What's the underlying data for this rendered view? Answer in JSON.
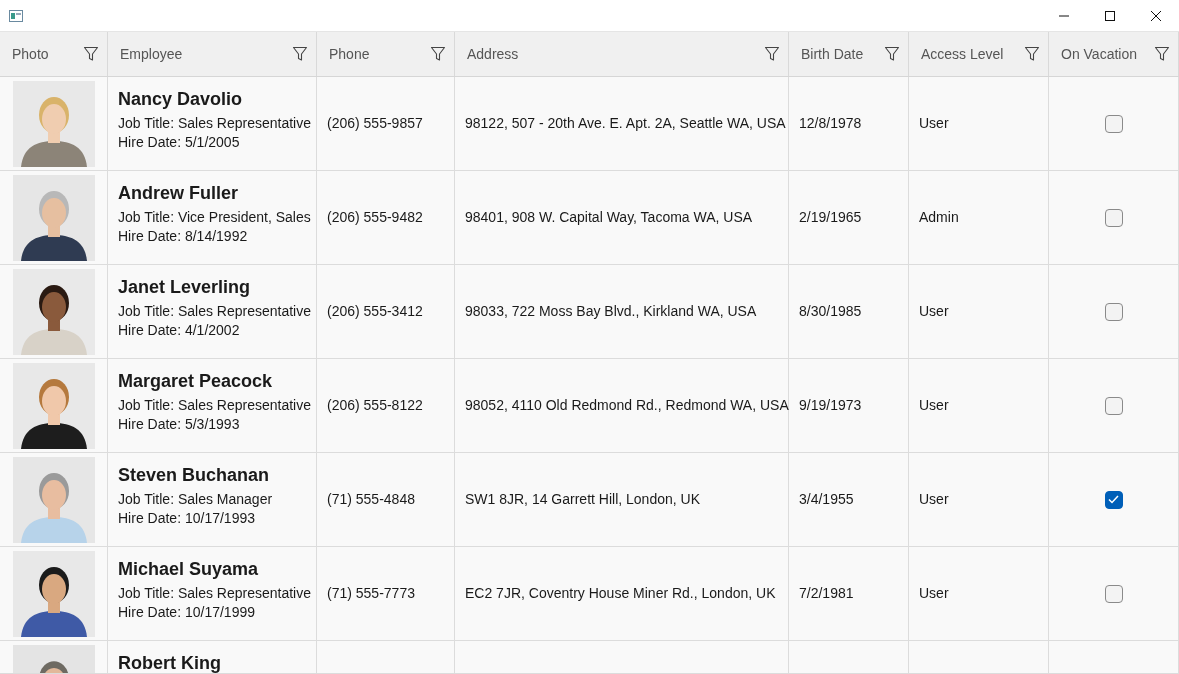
{
  "columns": [
    {
      "label": "Photo"
    },
    {
      "label": "Employee"
    },
    {
      "label": "Phone"
    },
    {
      "label": "Address"
    },
    {
      "label": "Birth Date"
    },
    {
      "label": "Access Level"
    },
    {
      "label": "On Vacation"
    }
  ],
  "rows": [
    {
      "name": "Nancy Davolio",
      "job_label": "Job Title:",
      "job": "Sales Representative",
      "hire_label": "Hire Date:",
      "hire": "5/1/2005",
      "phone": "(206) 555-9857",
      "address": "98122, 507 - 20th Ave. E. Apt. 2A, Seattle WA, USA",
      "birth": "12/8/1978",
      "access": "User",
      "on_vacation": false
    },
    {
      "name": "Andrew Fuller",
      "job_label": "Job Title:",
      "job": "Vice President, Sales",
      "hire_label": "Hire Date:",
      "hire": "8/14/1992",
      "phone": "(206) 555-9482",
      "address": "98401, 908 W. Capital Way, Tacoma WA, USA",
      "birth": "2/19/1965",
      "access": "Admin",
      "on_vacation": false
    },
    {
      "name": "Janet Leverling",
      "job_label": "Job Title:",
      "job": "Sales Representative",
      "hire_label": "Hire Date:",
      "hire": "4/1/2002",
      "phone": "(206) 555-3412",
      "address": "98033, 722 Moss Bay Blvd., Kirkland WA, USA",
      "birth": "8/30/1985",
      "access": "User",
      "on_vacation": false
    },
    {
      "name": "Margaret Peacock",
      "job_label": "Job Title:",
      "job": "Sales Representative",
      "hire_label": "Hire Date:",
      "hire": "5/3/1993",
      "phone": "(206) 555-8122",
      "address": "98052, 4110 Old Redmond Rd., Redmond WA, USA",
      "birth": "9/19/1973",
      "access": "User",
      "on_vacation": false
    },
    {
      "name": "Steven Buchanan",
      "job_label": "Job Title:",
      "job": "Sales Manager",
      "hire_label": "Hire Date:",
      "hire": "10/17/1993",
      "phone": "(71) 555-4848",
      "address": "SW1 8JR, 14 Garrett Hill, London, UK",
      "birth": "3/4/1955",
      "access": "User",
      "on_vacation": true
    },
    {
      "name": "Michael Suyama",
      "job_label": "Job Title:",
      "job": "Sales Representative",
      "hire_label": "Hire Date:",
      "hire": "10/17/1999",
      "phone": "(71) 555-7773",
      "address": "EC2 7JR, Coventry House Miner Rd., London, UK",
      "birth": "7/2/1981",
      "access": "User",
      "on_vacation": false
    },
    {
      "name": "Robert King"
    }
  ]
}
